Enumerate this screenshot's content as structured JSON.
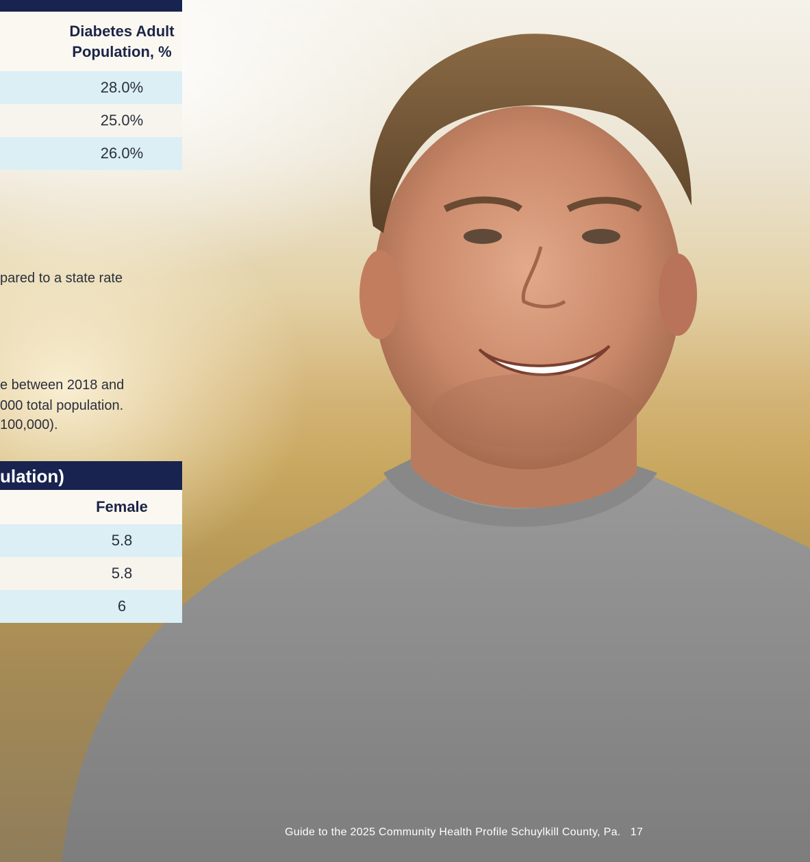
{
  "table1": {
    "column_header": "Diabetes Adult Population, %",
    "column_header_line1": "Diabetes Adult",
    "column_header_line2": "Population, %",
    "rows": [
      "28.0%",
      "25.0%",
      "26.0%"
    ]
  },
  "text": {
    "line1": "pared to a state rate",
    "line2": "e between 2018 and",
    "line3": "000 total population.",
    "line4": "100,000)."
  },
  "table2": {
    "title": "ulation)",
    "column_header": "Female",
    "rows": [
      "5.8",
      "5.8",
      "6"
    ]
  },
  "footer": {
    "text": "Guide to the 2025 Community Health Profile Schuylkill County, Pa.",
    "page_number": "17"
  },
  "colors": {
    "navy": "#18234f",
    "band": "#dbeff5"
  }
}
